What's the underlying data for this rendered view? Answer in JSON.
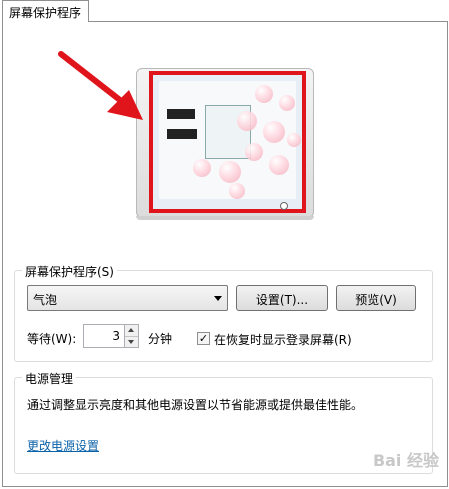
{
  "tab": {
    "label": "屏幕保护程序"
  },
  "screensaver_group": {
    "title": "屏幕保护程序(S)",
    "selected": "气泡",
    "settings_button": "设置(T)...",
    "preview_button": "预览(V)"
  },
  "wait": {
    "label": "等待(W):",
    "value": "3",
    "unit": "分钟",
    "resume_checkbox_label": "在恢复时显示登录屏幕(R)",
    "resume_checked": true
  },
  "power_group": {
    "title": "电源管理",
    "description": "通过调整显示亮度和其他电源设置以节省能源或提供最佳性能。",
    "link": "更改电源设置"
  },
  "watermark": {
    "text": "Bai 经验"
  },
  "colors": {
    "highlight_red": "#e0151c",
    "link_blue": "#0b62a9"
  },
  "icons": {
    "arrow": "red-arrow-icon",
    "power": "power-button-icon"
  }
}
